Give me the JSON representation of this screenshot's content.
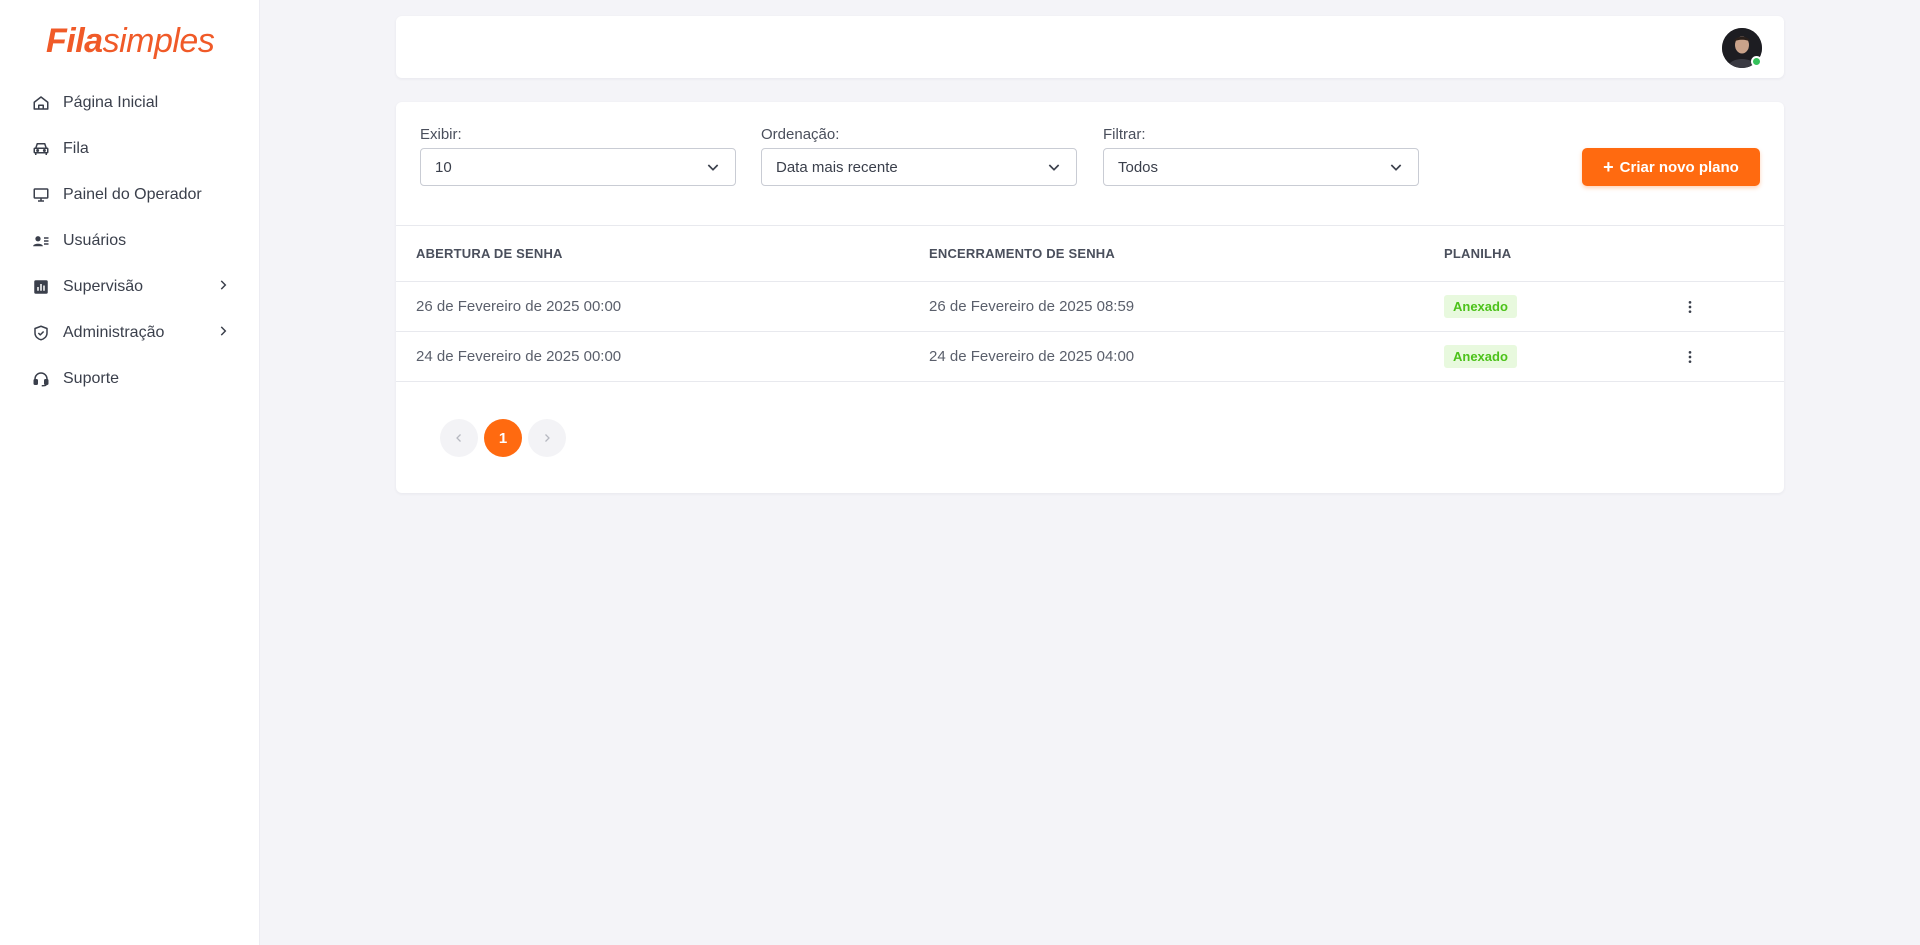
{
  "brand": {
    "logo_bold": "Fila",
    "logo_light": "simples",
    "accent": "#ff6a10",
    "logo_color": "#f05a28"
  },
  "sidebar": {
    "items": [
      {
        "label": "Página Inicial",
        "icon": "home-icon"
      },
      {
        "label": "Fila",
        "icon": "car-icon"
      },
      {
        "label": "Painel do Operador",
        "icon": "monitor-icon"
      },
      {
        "label": "Usuários",
        "icon": "user-list-icon"
      },
      {
        "label": "Supervisão",
        "icon": "bar-chart-icon",
        "expandable": true
      },
      {
        "label": "Administração",
        "icon": "shield-check-icon",
        "expandable": true
      },
      {
        "label": "Suporte",
        "icon": "headset-icon"
      }
    ]
  },
  "header": {
    "avatar_status": "online"
  },
  "filters": {
    "display": {
      "label": "Exibir:",
      "value": "10"
    },
    "order": {
      "label": "Ordenação:",
      "value": "Data mais recente"
    },
    "filter": {
      "label": "Filtrar:",
      "value": "Todos"
    }
  },
  "actions": {
    "create_label": "Criar novo plano",
    "create_icon": "+"
  },
  "table": {
    "columns": [
      "ABERTURA DE SENHA",
      "ENCERRAMENTO DE SENHA",
      "PLANILHA"
    ],
    "rows": [
      {
        "open": "26 de Fevereiro de 2025 00:00",
        "close": "26 de Fevereiro de 2025 08:59",
        "sheet": "Anexado"
      },
      {
        "open": "24 de Fevereiro de 2025 00:00",
        "close": "24 de Fevereiro de 2025 04:00",
        "sheet": "Anexado"
      }
    ]
  },
  "pagination": {
    "current": "1"
  }
}
